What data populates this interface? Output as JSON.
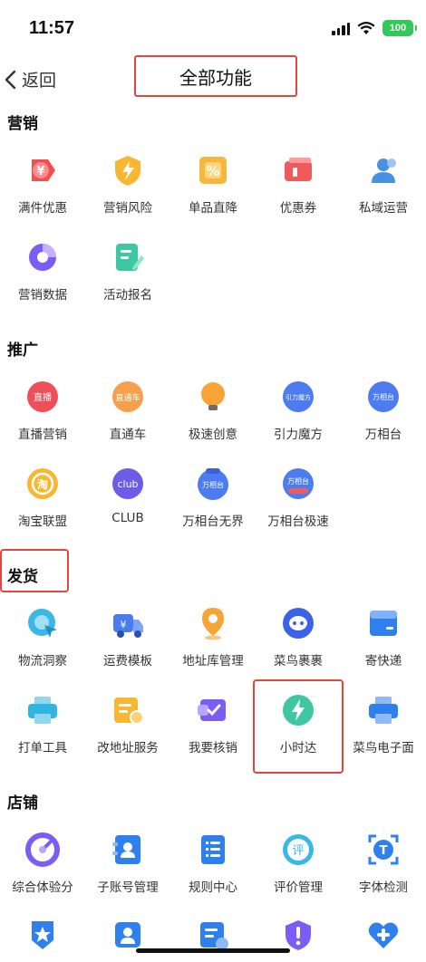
{
  "status": {
    "time": "11:57",
    "battery": "100"
  },
  "nav": {
    "back_label": "返回",
    "title": "全部功能"
  },
  "sections": {
    "marketing": {
      "title": "营销",
      "items": [
        {
          "label": "满件优惠",
          "icon": "yen-tag-icon",
          "color": "#f24e4e"
        },
        {
          "label": "营销风险",
          "icon": "lightning-shield-icon",
          "color": "#f7b733"
        },
        {
          "label": "单品直降",
          "icon": "percent-tag-icon",
          "color": "#f6b73c"
        },
        {
          "label": "优惠券",
          "icon": "coupon-icon",
          "color": "#f05a5a"
        },
        {
          "label": "私域运营",
          "icon": "users-icon",
          "color": "#4a90e2"
        },
        {
          "label": "营销数据",
          "icon": "pie-chart-icon",
          "color": "#7b5cf5"
        },
        {
          "label": "活动报名",
          "icon": "edit-form-icon",
          "color": "#3fc6a3"
        }
      ]
    },
    "promotion": {
      "title": "推广",
      "items": [
        {
          "label": "直播营销",
          "icon": "live-icon",
          "badge": "直播",
          "color": "#ef4f58"
        },
        {
          "label": "直通车",
          "icon": "express-car-icon",
          "badge": "直通车",
          "color": "#f6a04d"
        },
        {
          "label": "极速创意",
          "icon": "lightbulb-icon",
          "color": "#f7a436"
        },
        {
          "label": "引力魔方",
          "icon": "gravity-cube-icon",
          "badge": "引力魔方",
          "color": "#4c7cf0"
        },
        {
          "label": "万相台",
          "icon": "wanxiangtai-icon",
          "badge": "万相台",
          "color": "#4c7cf0"
        },
        {
          "label": "淘宝联盟",
          "icon": "taobao-union-icon",
          "badge": "淘",
          "color": "#f7b733"
        },
        {
          "label": "CLUB",
          "icon": "club-icon",
          "badge": "club",
          "color": "#6c5ce7"
        },
        {
          "label": "万相台无界",
          "icon": "wanxiangtai-wujie-icon",
          "badge": "万相台",
          "color": "#4c7cf0"
        },
        {
          "label": "万相台极速",
          "icon": "wanxiangtai-jisu-icon",
          "badge": "万相台",
          "color": "#4c7cf0"
        }
      ]
    },
    "shipping": {
      "title": "发货",
      "items": [
        {
          "label": "物流洞察",
          "icon": "logistics-insight-icon",
          "color": "#39b7e6"
        },
        {
          "label": "运费模板",
          "icon": "delivery-truck-icon",
          "color": "#4a7cf0"
        },
        {
          "label": "地址库管理",
          "icon": "location-pin-icon",
          "color": "#f7a436"
        },
        {
          "label": "菜鸟裹裹",
          "icon": "cainiao-guoguo-icon",
          "color": "#3c62e8"
        },
        {
          "label": "寄快递",
          "icon": "express-box-icon",
          "color": "#2f80ed"
        },
        {
          "label": "打单工具",
          "icon": "printer-icon",
          "color": "#2fb5e0"
        },
        {
          "label": "改地址服务",
          "icon": "address-change-icon",
          "color": "#f7b733"
        },
        {
          "label": "我要核销",
          "icon": "verify-icon",
          "color": "#7b5cf5"
        },
        {
          "label": "小时达",
          "icon": "hourly-delivery-icon",
          "color": "#3fc6a3"
        },
        {
          "label": "菜鸟电子面",
          "icon": "e-waybill-icon",
          "color": "#2f80ed"
        }
      ]
    },
    "store": {
      "title": "店铺",
      "items": [
        {
          "label": "综合体验分",
          "icon": "gauge-icon",
          "color": "#7b5cf5"
        },
        {
          "label": "子账号管理",
          "icon": "sub-account-icon",
          "color": "#2f80ed"
        },
        {
          "label": "规则中心",
          "icon": "rules-list-icon",
          "color": "#2f80ed"
        },
        {
          "label": "评价管理",
          "icon": "review-icon",
          "badge": "评",
          "color": "#39b7e6"
        },
        {
          "label": "字体检测",
          "icon": "font-check-icon",
          "color": "#2f80ed"
        },
        {
          "label": "",
          "icon": "star-shield-icon",
          "color": "#2f80ed"
        },
        {
          "label": "",
          "icon": "id-card-icon",
          "color": "#2f80ed"
        },
        {
          "label": "",
          "icon": "doc-check-icon",
          "color": "#2f80ed"
        },
        {
          "label": "",
          "icon": "alert-shield-icon",
          "color": "#7b5cf5"
        },
        {
          "label": "",
          "icon": "heart-plus-icon",
          "color": "#2f80ed"
        }
      ]
    }
  }
}
